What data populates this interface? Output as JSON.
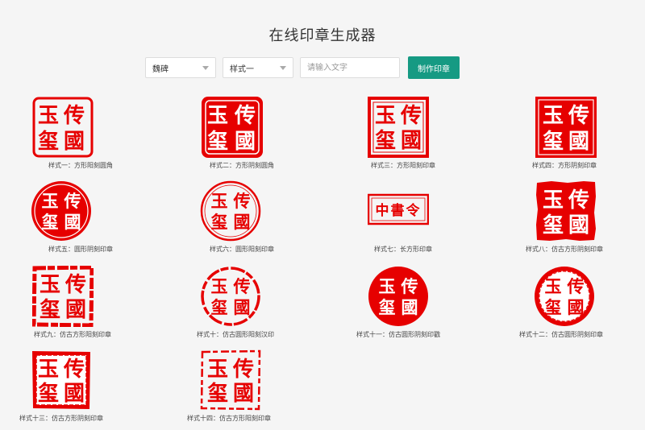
{
  "page": {
    "title": "在线印章生成器"
  },
  "controls": {
    "font_select": "魏碑",
    "style_select": "样式一",
    "text_placeholder": "请输入文字",
    "make_button": "制作印章"
  },
  "seals": [
    {
      "label": "样式一：方形阳刻圆角",
      "chars": [
        "玉",
        "传",
        "玺",
        "國"
      ]
    },
    {
      "label": "样式二：方形阴刻圆角",
      "chars": [
        "玉",
        "传",
        "玺",
        "國"
      ]
    },
    {
      "label": "样式三：方形阳刻印章",
      "chars": [
        "玉",
        "传",
        "玺",
        "國"
      ]
    },
    {
      "label": "样式四：方形阴刻印章",
      "chars": [
        "玉",
        "传",
        "玺",
        "國"
      ]
    },
    {
      "label": "样式五：圆形阴刻印章",
      "chars": [
        "玉",
        "传",
        "玺",
        "國"
      ]
    },
    {
      "label": "样式六：圆形阳刻印章",
      "chars": [
        "玉",
        "传",
        "玺",
        "國"
      ]
    },
    {
      "label": "样式七：长方形印章",
      "chars": [
        "中書令"
      ]
    },
    {
      "label": "样式八：仿古方形阴刻印章",
      "chars": [
        "玉",
        "传",
        "玺",
        "國"
      ]
    },
    {
      "label": "样式九：仿古方形阳刻印章",
      "chars": [
        "玉",
        "传",
        "玺",
        "國"
      ]
    },
    {
      "label": "样式十：仿古圆形阳刻汉印",
      "chars": [
        "玉",
        "传",
        "玺",
        "國"
      ]
    },
    {
      "label": "样式十一：仿古圆形阴刻印戳",
      "chars": [
        "玉",
        "传",
        "玺",
        "國"
      ]
    },
    {
      "label": "样式十二：仿古圆形阴刻印章",
      "chars": [
        "玉",
        "传",
        "玺",
        "國"
      ]
    },
    {
      "label": "样式十三：仿古方形阴刻印章",
      "chars": [
        "玉",
        "传",
        "玺",
        "國"
      ]
    },
    {
      "label": "样式十四：仿古方形阳刻印章",
      "chars": [
        "玉",
        "传",
        "玺",
        "國"
      ]
    }
  ],
  "colors": {
    "seal_red": "#e60000",
    "button_teal": "#169a83"
  },
  "icons": {
    "select_caret": "chevron-down-icon"
  }
}
